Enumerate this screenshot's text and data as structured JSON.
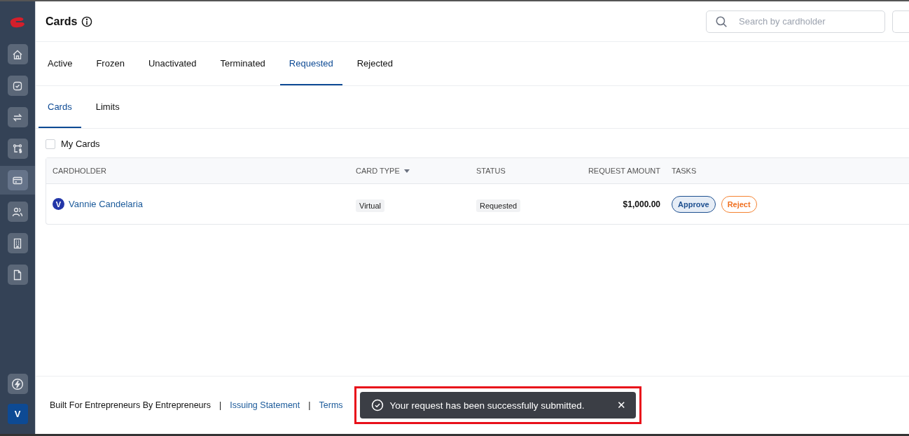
{
  "sidebar": {
    "items": [
      {
        "selected": false
      },
      {
        "selected": false
      },
      {
        "selected": false
      },
      {
        "selected": false
      },
      {
        "selected": true
      },
      {
        "selected": false
      },
      {
        "selected": false
      },
      {
        "selected": false
      }
    ],
    "user_initial": "V"
  },
  "header": {
    "title": "Cards",
    "search": {
      "placeholder": "Search by cardholder"
    }
  },
  "tabs": [
    {
      "label": "Active",
      "selected": false
    },
    {
      "label": "Frozen",
      "selected": false
    },
    {
      "label": "Unactivated",
      "selected": false
    },
    {
      "label": "Terminated",
      "selected": false
    },
    {
      "label": "Requested",
      "selected": true
    },
    {
      "label": "Rejected",
      "selected": false
    }
  ],
  "subtabs": [
    {
      "label": "Cards",
      "selected": true
    },
    {
      "label": "Limits",
      "selected": false
    }
  ],
  "filter": {
    "label": "My Cards",
    "checked": false
  },
  "table": {
    "columns": [
      {
        "label": "CARDHOLDER",
        "sortable": false
      },
      {
        "label": "CARD TYPE",
        "sortable": true
      },
      {
        "label": "STATUS",
        "sortable": false
      },
      {
        "label": "REQUEST AMOUNT",
        "sortable": false
      },
      {
        "label": "TASKS",
        "sortable": false
      }
    ],
    "rows": [
      {
        "initial": "V",
        "cardholder": "Vannie Candelaria",
        "card_type": "Virtual",
        "status": "Requested",
        "amount": "$1,000.00",
        "actions": [
          "Approve",
          "Reject"
        ]
      }
    ]
  },
  "footer": {
    "tagline": "Built For Entrepreneurs By Entrepreneurs",
    "separator": "|",
    "links": [
      "Issuing Statement",
      "Terms"
    ]
  },
  "toast": {
    "message": "Your request has been successfully submitted.",
    "close": "✕",
    "highlighted": true
  }
}
